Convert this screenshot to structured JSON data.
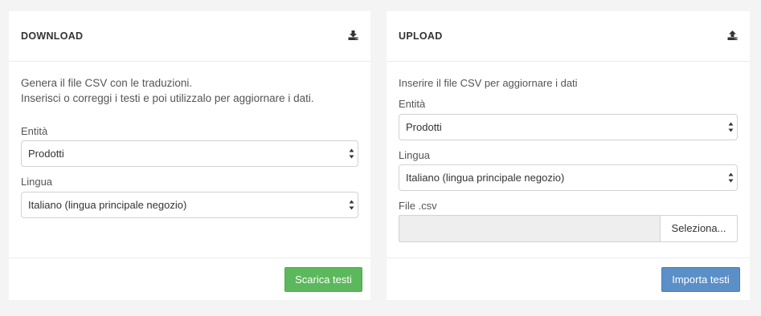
{
  "download": {
    "title": "DOWNLOAD",
    "icon": "download-icon",
    "description_line1": "Genera il file CSV con le traduzioni.",
    "description_line2": "Inserisci o correggi i testi e poi utilizzalo per aggiornare i dati.",
    "entity_label": "Entità",
    "entity_value": "Prodotti",
    "language_label": "Lingua",
    "language_value": "Italiano (lingua principale negozio)",
    "button_label": "Scarica testi"
  },
  "upload": {
    "title": "UPLOAD",
    "icon": "upload-icon",
    "description": "Inserire il file CSV per aggiornare i dati",
    "entity_label": "Entità",
    "entity_value": "Prodotti",
    "language_label": "Lingua",
    "language_value": "Italiano (lingua principale negozio)",
    "file_label": "File .csv",
    "file_button_label": "Seleziona...",
    "button_label": "Importa testi"
  },
  "colors": {
    "background": "#f4f4f4",
    "green_button": "#5cb85c",
    "blue_button": "#5b8fc7"
  }
}
